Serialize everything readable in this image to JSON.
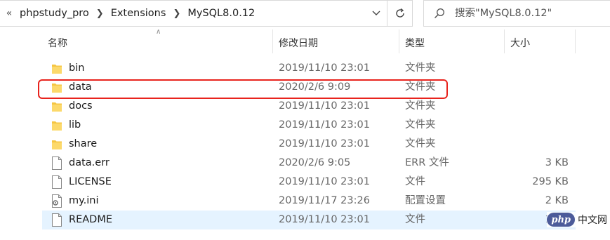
{
  "address_bar": {
    "crumbs": [
      "phpstudy_pro",
      "Extensions",
      "MySQL8.0.12"
    ],
    "back_chevron": "«",
    "dropdown_icon": "chevron-down-icon"
  },
  "search": {
    "placeholder": "搜索\"MySQL8.0.12\""
  },
  "columns": {
    "name": "名称",
    "date": "修改日期",
    "type": "类型",
    "size": "大小"
  },
  "files": [
    {
      "name": "bin",
      "date": "2019/11/10 23:01",
      "type": "文件夹",
      "size": "",
      "icon": "folder-icon"
    },
    {
      "name": "data",
      "date": "2020/2/6 9:09",
      "type": "文件夹",
      "size": "",
      "icon": "folder-icon"
    },
    {
      "name": "docs",
      "date": "2019/11/10 23:01",
      "type": "文件夹",
      "size": "",
      "icon": "folder-icon"
    },
    {
      "name": "lib",
      "date": "2019/11/10 23:01",
      "type": "文件夹",
      "size": "",
      "icon": "folder-icon"
    },
    {
      "name": "share",
      "date": "2019/11/10 23:01",
      "type": "文件夹",
      "size": "",
      "icon": "folder-icon"
    },
    {
      "name": "data.err",
      "date": "2020/2/6 9:05",
      "type": "ERR 文件",
      "size": "3 KB",
      "icon": "file-icon"
    },
    {
      "name": "LICENSE",
      "date": "2019/11/10 23:01",
      "type": "文件",
      "size": "295 KB",
      "icon": "file-icon"
    },
    {
      "name": "my.ini",
      "date": "2019/11/17 23:26",
      "type": "配置设置",
      "size": "2 KB",
      "icon": "settings-file-icon"
    },
    {
      "name": "README",
      "date": "2019/11/10 23:01",
      "type": "文件",
      "size": "1 KB",
      "icon": "file-icon"
    }
  ],
  "selected_row": "README",
  "highlighted_row": "data",
  "watermark": {
    "logo": "php",
    "text": "中文网"
  },
  "colors": {
    "highlight": "#e8231d",
    "selection": "#e5f3ff",
    "folder": "#f5c542"
  }
}
